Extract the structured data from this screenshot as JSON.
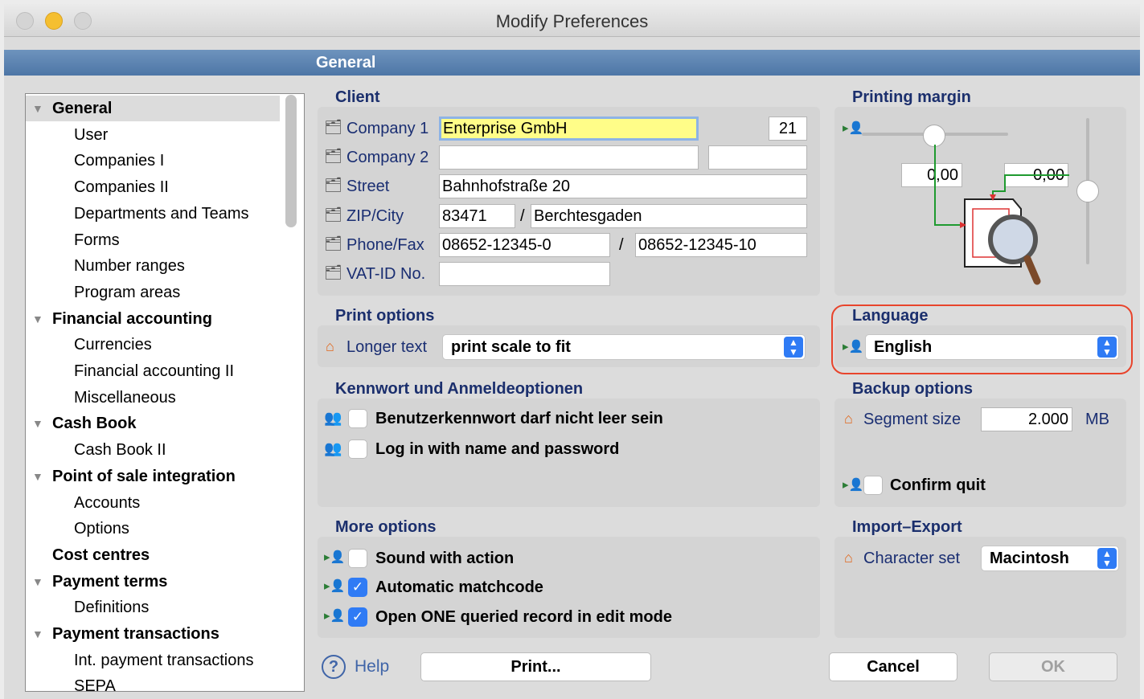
{
  "window": {
    "title": "Modify Preferences"
  },
  "section": {
    "title": "General"
  },
  "tree": {
    "items": [
      {
        "label": "General",
        "bold": true,
        "expanded": true,
        "selected": true
      },
      {
        "label": "User"
      },
      {
        "label": "Companies I"
      },
      {
        "label": "Companies II"
      },
      {
        "label": "Departments and Teams"
      },
      {
        "label": "Forms"
      },
      {
        "label": "Number ranges"
      },
      {
        "label": "Program areas"
      },
      {
        "label": "Financial accounting",
        "bold": true,
        "expanded": true
      },
      {
        "label": "Currencies"
      },
      {
        "label": "Financial accounting II"
      },
      {
        "label": "Miscellaneous"
      },
      {
        "label": "Cash Book",
        "bold": true,
        "expanded": true
      },
      {
        "label": "Cash Book II"
      },
      {
        "label": "Point of sale integration",
        "bold": true,
        "expanded": true
      },
      {
        "label": "Accounts"
      },
      {
        "label": "Options"
      },
      {
        "label": "Cost centres",
        "bold": true
      },
      {
        "label": "Payment terms",
        "bold": true,
        "expanded": true
      },
      {
        "label": "Definitions"
      },
      {
        "label": "Payment transactions",
        "bold": true,
        "expanded": true
      },
      {
        "label": "Int. payment transactions"
      },
      {
        "label": "SEPA"
      }
    ]
  },
  "client": {
    "title": "Client",
    "company1": {
      "label": "Company 1",
      "value": "Enterprise GmbH",
      "number": "21"
    },
    "company2": {
      "label": "Company 2",
      "value": "",
      "extra": ""
    },
    "street": {
      "label": "Street",
      "value": "Bahnhofstraße 20"
    },
    "zipcity": {
      "label": "ZIP/City",
      "zip": "83471",
      "sep": "/",
      "city": "Berchtesgaden"
    },
    "phonefax": {
      "label": "Phone/Fax",
      "phone": "08652-12345-0",
      "sep": "/",
      "fax": "08652-12345-10"
    },
    "vat": {
      "label": "VAT-ID No.",
      "value": ""
    }
  },
  "printing_margin": {
    "title": "Printing margin",
    "left": "0,00",
    "right": "0,00"
  },
  "print_options": {
    "title": "Print options",
    "longer_text_label": "Longer text",
    "longer_text_value": "print scale to fit"
  },
  "language": {
    "title": "Language",
    "value": "English"
  },
  "password": {
    "title": "Kennwort und Anmeldeoptionen",
    "opt1": {
      "label": "Benutzerkennwort darf nicht leer sein",
      "checked": false
    },
    "opt2": {
      "label": "Log in with name and password",
      "checked": false
    }
  },
  "backup": {
    "title": "Backup options",
    "segment_label": "Segment size",
    "segment_value": "2.000",
    "segment_unit": "MB",
    "confirm_quit": {
      "label": "Confirm quit",
      "checked": false
    }
  },
  "more": {
    "title": "More options",
    "sound": {
      "label": "Sound with action",
      "checked": false
    },
    "matchcode": {
      "label": "Automatic matchcode",
      "checked": true
    },
    "open_one": {
      "label": "Open ONE queried record in edit mode",
      "checked": true
    }
  },
  "import_export": {
    "title": "Import–Export",
    "charset_label": "Character set",
    "charset_value": "Macintosh"
  },
  "buttons": {
    "help": "Help",
    "print": "Print...",
    "cancel": "Cancel",
    "ok": "OK"
  },
  "colors": {
    "section_bar": "#5b82b0",
    "accent": "#2f7bf5",
    "highlight_ring": "#e8442c",
    "title_text": "#1b2f6d"
  },
  "icons": {
    "user": "user-arrow-icon",
    "house": "house-icon",
    "address": "address-card-icon",
    "people": "people-icon",
    "help": "help-circle-icon"
  }
}
